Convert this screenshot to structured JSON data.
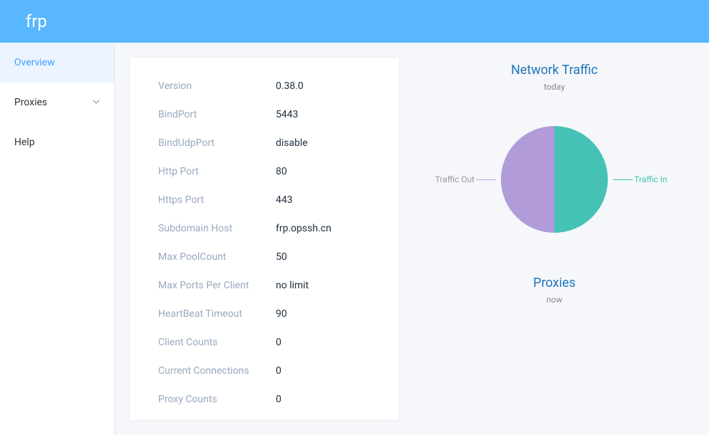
{
  "header": {
    "title": "frp"
  },
  "sidebar": {
    "items": [
      {
        "label": "Overview"
      },
      {
        "label": "Proxies"
      },
      {
        "label": "Help"
      }
    ]
  },
  "info": {
    "rows": [
      {
        "label": "Version",
        "value": "0.38.0"
      },
      {
        "label": "BindPort",
        "value": "5443"
      },
      {
        "label": "BindUdpPort",
        "value": "disable"
      },
      {
        "label": "Http Port",
        "value": "80"
      },
      {
        "label": "Https Port",
        "value": "443"
      },
      {
        "label": "Subdomain Host",
        "value": "frp.opssh.cn"
      },
      {
        "label": "Max PoolCount",
        "value": "50"
      },
      {
        "label": "Max Ports Per Client",
        "value": "no limit"
      },
      {
        "label": "HeartBeat Timeout",
        "value": "90"
      },
      {
        "label": "Client Counts",
        "value": "0"
      },
      {
        "label": "Current Connections",
        "value": "0"
      },
      {
        "label": "Proxy Counts",
        "value": "0"
      }
    ]
  },
  "charts": {
    "traffic": {
      "title": "Network Traffic",
      "sub": "today",
      "leftLabel": "Traffic Out",
      "rightLabel": "Traffic In"
    },
    "proxies": {
      "title": "Proxies",
      "sub": "now"
    }
  },
  "chart_data": [
    {
      "type": "pie",
      "title": "Network Traffic",
      "subtitle": "today",
      "series": [
        {
          "name": "Traffic Out",
          "value": 50,
          "color": "#b19cd9"
        },
        {
          "name": "Traffic In",
          "value": 50,
          "color": "#45c2b5"
        }
      ]
    },
    {
      "type": "pie",
      "title": "Proxies",
      "subtitle": "now",
      "series": []
    }
  ],
  "colors": {
    "accent": "#58b7ff",
    "link": "#409eff",
    "purple": "#b19cd9",
    "teal": "#45c2b5"
  }
}
